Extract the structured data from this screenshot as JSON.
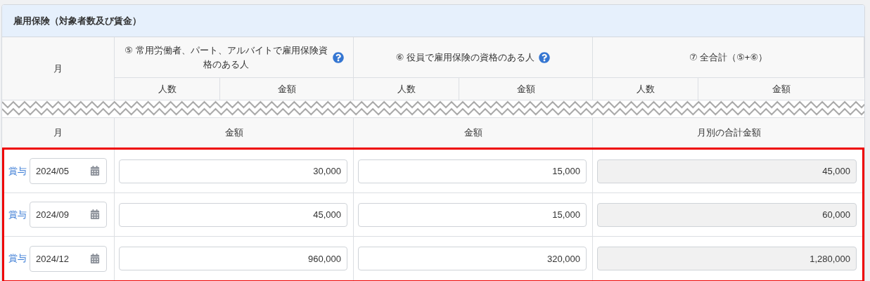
{
  "section": {
    "title": "雇用保険（対象者数及び賃金）"
  },
  "header": {
    "month_label": "月",
    "groups": [
      {
        "label": "⑤ 常用労働者、パート、アルバイトで雇用保険資格のある人",
        "help": true,
        "subcolumns": [
          "人数",
          "金額"
        ]
      },
      {
        "label": "⑥ 役員で雇用保険の資格のある人",
        "help": true,
        "subcolumns": [
          "人数",
          "金額"
        ]
      },
      {
        "label": "⑦ 全合計（⑤+⑥）",
        "help": false,
        "subcolumns": [
          "人数",
          "金額"
        ]
      }
    ]
  },
  "lower_header": [
    "月",
    "金額",
    "金額",
    "月別の合計金額"
  ],
  "rows": [
    {
      "label": "賞与",
      "month": "2024/05",
      "amount_5": "30,000",
      "amount_6": "15,000",
      "total": "45,000",
      "total_readonly": true
    },
    {
      "label": "賞与",
      "month": "2024/09",
      "amount_5": "45,000",
      "amount_6": "15,000",
      "total": "60,000",
      "total_readonly": true
    },
    {
      "label": "賞与",
      "month": "2024/12",
      "amount_5": "960,000",
      "amount_6": "320,000",
      "total": "1,280,000",
      "total_readonly": true
    }
  ]
}
